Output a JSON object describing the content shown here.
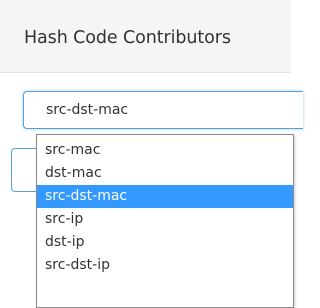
{
  "panel": {
    "title": "Hash Code Contributors"
  },
  "select": {
    "value": "src-dst-mac",
    "options": [
      {
        "label": "src-mac",
        "selected": false
      },
      {
        "label": "dst-mac",
        "selected": false
      },
      {
        "label": "src-dst-mac",
        "selected": true
      },
      {
        "label": "src-ip",
        "selected": false
      },
      {
        "label": "dst-ip",
        "selected": false
      },
      {
        "label": "src-dst-ip",
        "selected": false
      }
    ]
  },
  "colors": {
    "highlight": "#3399ff",
    "focus_border": "#5aa0d8",
    "header_bg": "#f5f5f5"
  }
}
